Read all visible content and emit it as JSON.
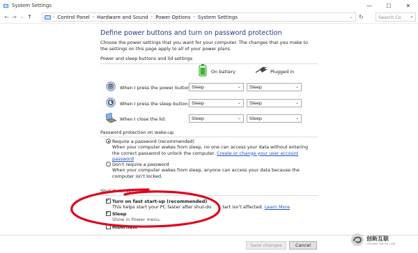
{
  "window": {
    "title": "System Settings"
  },
  "address": {
    "crumbs": [
      "Control Panel",
      "Hardware and Sound",
      "Power Options",
      "System Settings"
    ],
    "search_placeholder": "Search Co"
  },
  "page": {
    "heading": "Define power buttons and turn on password protection",
    "description": "Choose the power settings that you want for your computer. The changes that you make to the settings on this page apply to all of your power plans."
  },
  "power": {
    "section_title": "Power and sleep buttons and lid settings",
    "columns": [
      "On battery",
      "Plugged in"
    ],
    "rows": [
      {
        "label": "When I press the power button:",
        "icon": "power-button-icon",
        "battery": "Sleep",
        "plugged": "Sleep"
      },
      {
        "label": "When I press the sleep button:",
        "icon": "sleep-button-icon",
        "battery": "Sleep",
        "plugged": "Sleep"
      },
      {
        "label": "When I close the lid:",
        "icon": "laptop-lid-icon",
        "battery": "Sleep",
        "plugged": "Sleep"
      }
    ]
  },
  "password": {
    "section_title": "Password protection on wake-up",
    "require_label": "Require a password (recommended)",
    "require_desc": "When your computer wakes from sleep, no one can access your data without entering the correct password to unlock the computer.",
    "require_link": "Create or change your user account password",
    "no_require_label": "Don't require a password",
    "no_require_desc": "When your computer wakes from sleep, anyone can access your data because the computer isn't locked."
  },
  "shutdown": {
    "section_title": "Shut-down settings",
    "fast_label": "Turn on fast start-up (recommended)",
    "fast_desc_a": "This helps start your PC faster after shut-do",
    "fast_desc_b": "tart isn't affected.",
    "fast_link": "Learn More",
    "sleep_label": "Sleep",
    "sleep_desc": "Show in Power menu.",
    "hibernate_label": "Hibernate"
  },
  "footer": {
    "save_label": "Save changes",
    "cancel_label": "Cancel"
  },
  "watermark": {
    "text": "创新互联",
    "sub": "CHUANG XIN HU LIAN"
  },
  "colors": {
    "heading": "#1e3a8a",
    "link": "#1a4fc7",
    "annotation": "#e0001b"
  }
}
